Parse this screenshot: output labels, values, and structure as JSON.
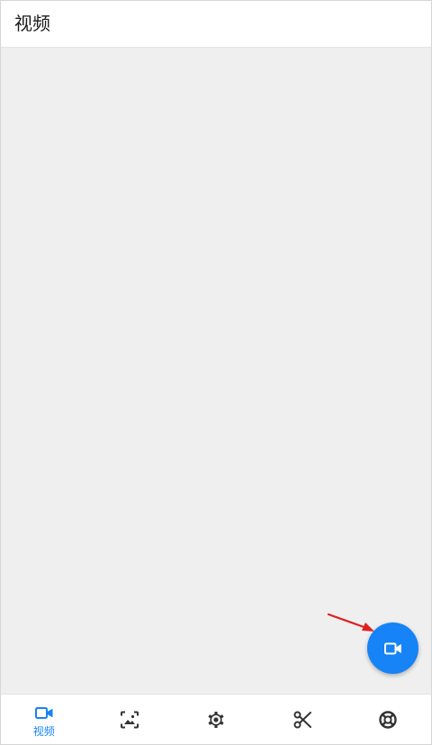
{
  "app_bar": {
    "title": "视频"
  },
  "fab": {
    "icon": "video-camera-icon",
    "color": "#1683f7"
  },
  "annotation": {
    "type": "arrow",
    "color": "#e02020",
    "points_to": "fab"
  },
  "bottom_nav": {
    "active_color": "#1683f7",
    "inactive_color": "#333333",
    "items": [
      {
        "icon": "video-camera-icon",
        "label": "视频",
        "active": true
      },
      {
        "icon": "image-frame-icon",
        "label": "",
        "active": false
      },
      {
        "icon": "gear-icon",
        "label": "",
        "active": false
      },
      {
        "icon": "scissors-icon",
        "label": "",
        "active": false
      },
      {
        "icon": "lifebuoy-icon",
        "label": "",
        "active": false
      }
    ]
  }
}
